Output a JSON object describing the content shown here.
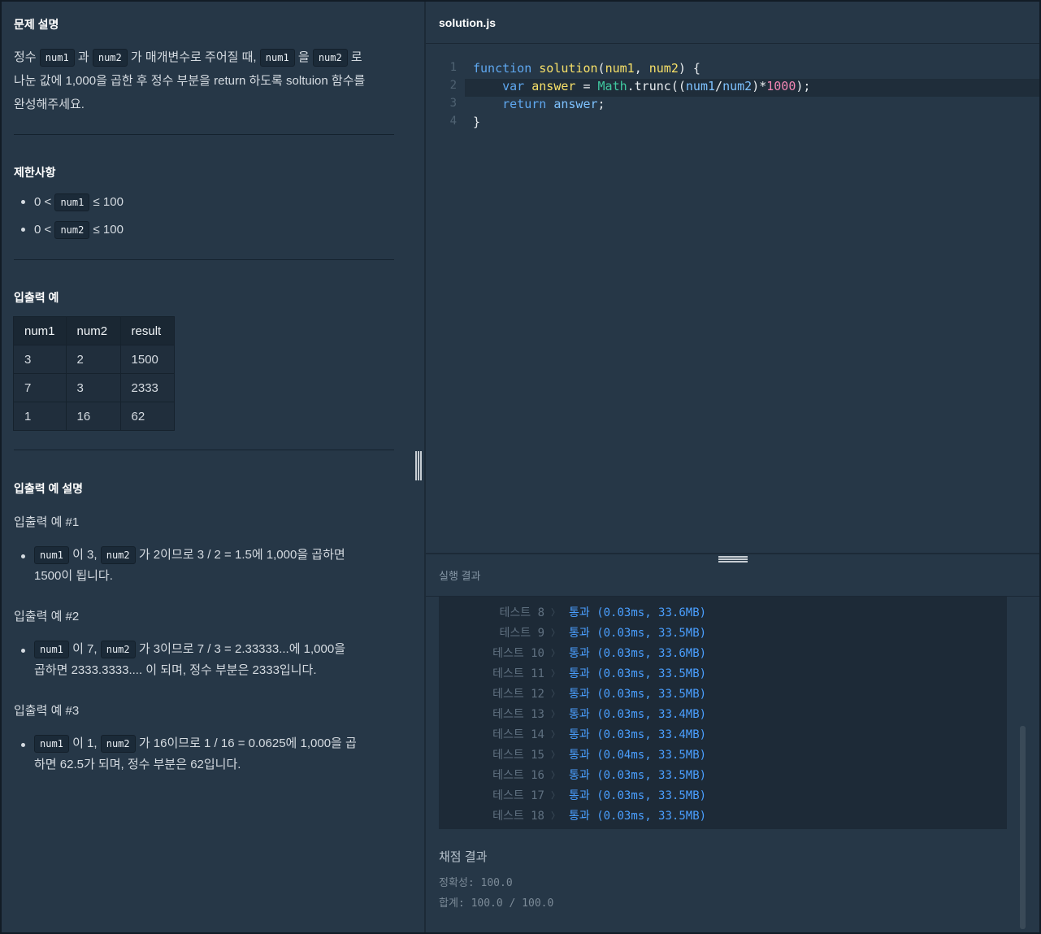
{
  "problem": {
    "heading": "문제 설명",
    "desc": {
      "p1": "정수",
      "c1": "num1",
      "p2": "과",
      "c2": "num2",
      "p3": "가 매개변수로 주어질 때,",
      "c3": "num1",
      "p4": "을",
      "c4": "num2",
      "p5": "로",
      "line2": "나눈 값에 1,000을 곱한 후 정수 부분을 return 하도록 soltuion 함수를",
      "line3": "완성해주세요."
    }
  },
  "constraints": {
    "heading": "제한사항",
    "items": [
      {
        "pre": "0 <",
        "code": "num1",
        "post": "≤ 100"
      },
      {
        "pre": "0 <",
        "code": "num2",
        "post": "≤ 100"
      }
    ]
  },
  "io_example": {
    "heading": "입출력 예",
    "headers": [
      "num1",
      "num2",
      "result"
    ],
    "rows": [
      [
        "3",
        "2",
        "1500"
      ],
      [
        "7",
        "3",
        "2333"
      ],
      [
        "1",
        "16",
        "62"
      ]
    ]
  },
  "io_explain": {
    "heading": "입출력 예 설명",
    "examples": [
      {
        "title": "입출력 예 #1",
        "c1": "num1",
        "t1": "이 3,",
        "c2": "num2",
        "t2": "가 2이므로 3 / 2 = 1.5에 1,000을 곱하면",
        "t3": "1500이 됩니다."
      },
      {
        "title": "입출력 예 #2",
        "c1": "num1",
        "t1": "이 7,",
        "c2": "num2",
        "t2": "가 3이므로 7 / 3 = 2.33333...에 1,000을",
        "t3": "곱하면 2333.3333.... 이 되며, 정수 부분은 2333입니다."
      },
      {
        "title": "입출력 예 #3",
        "c1": "num1",
        "t1": "이 1,",
        "c2": "num2",
        "t2": "가 16이므로 1 / 16 = 0.0625에 1,000을 곱",
        "t3": "하면 62.5가 되며, 정수 부분은 62입니다."
      }
    ]
  },
  "editor": {
    "tab_title": "solution.js",
    "line_numbers": [
      "1",
      "2",
      "3",
      "4"
    ]
  },
  "results": {
    "heading": "실행 결과",
    "rows": [
      {
        "label": "테스트 8",
        "result": "통과 (0.03ms, 33.6MB)"
      },
      {
        "label": "테스트 9",
        "result": "통과 (0.03ms, 33.5MB)"
      },
      {
        "label": "테스트 10",
        "result": "통과 (0.03ms, 33.6MB)"
      },
      {
        "label": "테스트 11",
        "result": "통과 (0.03ms, 33.5MB)"
      },
      {
        "label": "테스트 12",
        "result": "통과 (0.03ms, 33.5MB)"
      },
      {
        "label": "테스트 13",
        "result": "통과 (0.03ms, 33.4MB)"
      },
      {
        "label": "테스트 14",
        "result": "통과 (0.03ms, 33.4MB)"
      },
      {
        "label": "테스트 15",
        "result": "통과 (0.04ms, 33.5MB)"
      },
      {
        "label": "테스트 16",
        "result": "통과 (0.03ms, 33.5MB)"
      },
      {
        "label": "테스트 17",
        "result": "통과 (0.03ms, 33.5MB)"
      },
      {
        "label": "테스트 18",
        "result": "통과 (0.03ms, 33.5MB)"
      }
    ],
    "score_heading": "채점 결과",
    "accuracy": "정확성: 100.0",
    "total": "합계: 100.0 / 100.0"
  }
}
